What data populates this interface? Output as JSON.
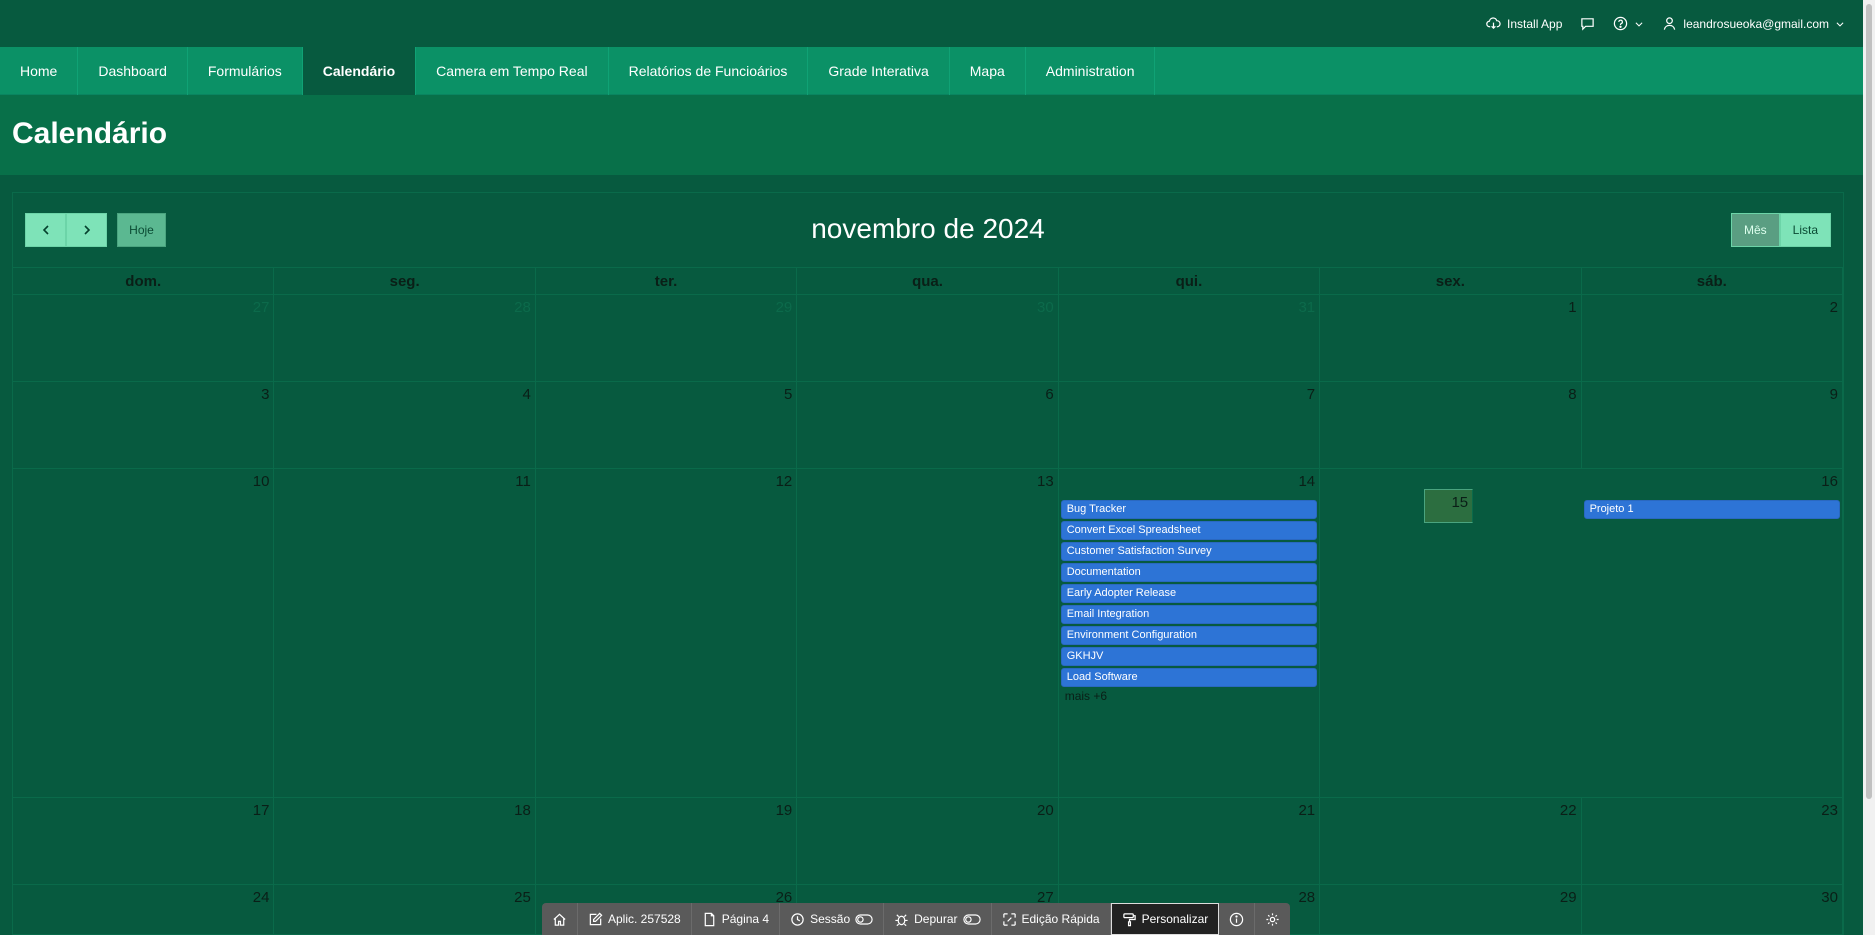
{
  "header": {
    "install_app": "Install App",
    "user_email": "leandrosueoka@gmail.com"
  },
  "nav": {
    "tabs": [
      {
        "label": "Home"
      },
      {
        "label": "Dashboard"
      },
      {
        "label": "Formulários"
      },
      {
        "label": "Calendário",
        "active": true
      },
      {
        "label": "Camera em Tempo Real"
      },
      {
        "label": "Relatórios de Funcioários"
      },
      {
        "label": "Grade Interativa"
      },
      {
        "label": "Mapa"
      },
      {
        "label": "Administration"
      }
    ]
  },
  "page": {
    "title": "Calendário"
  },
  "calendar": {
    "today_label": "Hoje",
    "month_title": "novembro de 2024",
    "views": {
      "month": "Mês",
      "list": "Lista"
    },
    "weekdays": [
      "dom.",
      "seg.",
      "ter.",
      "qua.",
      "qui.",
      "sex.",
      "sáb."
    ],
    "weeks": [
      [
        "27",
        "28",
        "29",
        "30",
        "31",
        "1",
        "2"
      ],
      [
        "3",
        "4",
        "5",
        "6",
        "7",
        "8",
        "9"
      ],
      [
        "10",
        "11",
        "12",
        "13",
        "14",
        "15",
        "16"
      ],
      [
        "17",
        "18",
        "19",
        "20",
        "21",
        "22",
        "23"
      ],
      [
        "24",
        "25",
        "26",
        "27",
        "28",
        "29",
        "30"
      ]
    ],
    "events_thu_14": [
      "Bug Tracker",
      "Convert Excel Spreadsheet",
      "Customer Satisfaction Survey",
      "Documentation",
      "Early Adopter Release",
      "Email Integration",
      "Environment Configuration",
      "GKHJV",
      "Load Software"
    ],
    "more_thu_14": "mais +6",
    "events_sat_16": [
      "Projeto 1"
    ]
  },
  "devbar": {
    "app": "Aplic. 257528",
    "page": "Página 4",
    "session": "Sessão",
    "debug": "Depurar",
    "quick_edit": "Edição Rápida",
    "customize": "Personalizar"
  },
  "colors": {
    "background": "#075a3f",
    "nav": "#0b9166",
    "event": "#2d74d6",
    "today_cell": "#2c6e40"
  }
}
